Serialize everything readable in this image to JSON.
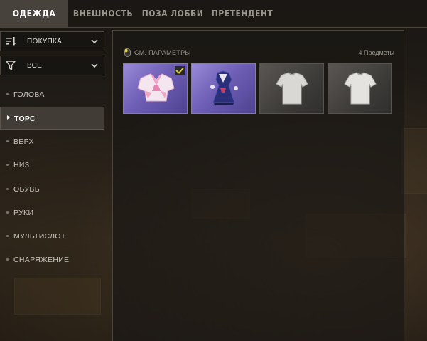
{
  "tabs": [
    {
      "label": "ОДЕЖДА",
      "active": true
    },
    {
      "label": "ВНЕШНОСТЬ",
      "active": false
    },
    {
      "label": "ПОЗА ЛОББИ",
      "active": false
    },
    {
      "label": "ПРЕТЕНДЕНТ",
      "active": false
    }
  ],
  "sidebar": {
    "sort_dropdown": {
      "label": "ПОКУПКА",
      "icon": "sort-icon"
    },
    "filter_dropdown": {
      "label": "ВСЕ",
      "icon": "filter-icon"
    },
    "categories": [
      {
        "label": "ГОЛОВА",
        "active": false
      },
      {
        "label": "ТОРС",
        "active": true
      },
      {
        "label": "ВЕРХ",
        "active": false
      },
      {
        "label": "НИЗ",
        "active": false
      },
      {
        "label": "ОБУВЬ",
        "active": false
      },
      {
        "label": "РУКИ",
        "active": false
      },
      {
        "label": "МУЛЬТИСЛОТ",
        "active": false
      },
      {
        "label": "СНАРЯЖЕНИЕ",
        "active": false
      }
    ]
  },
  "panel": {
    "settings_label": "СМ. ПАРАМЕТРЫ",
    "count_label": "4 Предметы",
    "items": [
      {
        "name": "pink-sailor-top",
        "rarity_color": "#7b6bc8",
        "equipped": true
      },
      {
        "name": "blue-sailor-outfit",
        "rarity_color": "#7b6bc8",
        "equipped": false
      },
      {
        "name": "white-tshirt",
        "rarity_color": "#4a4743",
        "equipped": false
      },
      {
        "name": "white-tshirt",
        "rarity_color": "#4a4743",
        "equipped": false
      }
    ]
  },
  "colors": {
    "accent_check": "#d6c94a",
    "tab_active_bg": "#47423b"
  }
}
